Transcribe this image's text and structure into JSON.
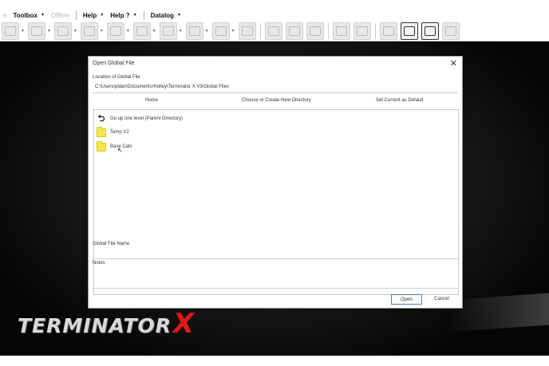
{
  "menu": {
    "items": [
      {
        "label": "Toolbox",
        "dropdown": true
      },
      {
        "label": "Offline",
        "dropdown": false,
        "disabled": true
      },
      {
        "label": "Help",
        "dropdown": true
      },
      {
        "label": "Help ?",
        "dropdown": true
      },
      {
        "label": "Datalog",
        "dropdown": true
      }
    ],
    "dropdown_glyph": "▼",
    "edge_glyph": "e"
  },
  "toolbar": {
    "icons": [
      "plug-icon",
      "gauge-icon",
      "wrench-icon",
      "table-icon",
      "sensor-icon",
      "joystick-icon",
      "injector-icon",
      "spark-icon",
      "fuel-rail-icon",
      "ramp-icon",
      "copy-icon",
      "grid-icon",
      "graph-icon",
      "monitor-icon",
      "edit-icon",
      "tape-icon",
      "ecg-icon",
      "list-icon",
      "split-icon"
    ],
    "active": [
      "ecg-icon",
      "list-icon"
    ]
  },
  "dialog": {
    "title": "Open Global File",
    "close_glyph": "✕",
    "location_label": "Location of Global File",
    "location_path": "C:\\Users\\pldan\\Documents\\Holley\\Terminator X V3\\Global Files",
    "links": {
      "home": "Home",
      "choose": "Choose or Create New Directory",
      "set_default": "Set Current as Default"
    },
    "entries": [
      {
        "label": "Go up one level (Parent Directory)",
        "icon": "up-arrow-icon"
      },
      {
        "label": "Temp V2",
        "icon": "folder-icon"
      },
      {
        "label": "Base Cals",
        "icon": "folder-icon"
      }
    ],
    "filename_label": "Global File Name",
    "filename_value": "",
    "notes_label": "Notes",
    "notes_value": "",
    "open_label": "Open",
    "cancel_label": "Cancel"
  },
  "branding": {
    "logo_text": "TERMINATOR",
    "logo_x": "X",
    "accent_color": "#e01818"
  }
}
